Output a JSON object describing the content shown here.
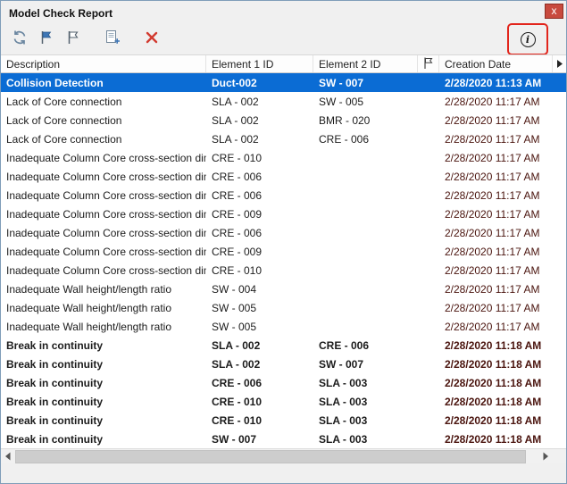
{
  "window": {
    "title": "Model Check Report",
    "close_glyph": "x"
  },
  "toolbar": {
    "icons": [
      {
        "name": "check-model-icon"
      },
      {
        "name": "flag-icon"
      },
      {
        "name": "unflag-icon"
      },
      {
        "name": "new-report-icon"
      },
      {
        "name": "delete-icon"
      },
      {
        "name": "info-icon"
      }
    ]
  },
  "table": {
    "columns": [
      "Description",
      "Element 1 ID",
      "Element 2 ID",
      "",
      "Creation Date"
    ],
    "flag_column_icon": "flag-icon",
    "rows": [
      {
        "description": "Collision Detection",
        "element1_id": "Duct-002",
        "element2_id": "SW - 007",
        "creation_date": "2/28/2020 11:13 AM",
        "selected": true,
        "bold": true
      },
      {
        "description": "Lack of Core connection",
        "element1_id": "SLA - 002",
        "element2_id": "SW - 005",
        "creation_date": "2/28/2020 11:17 AM",
        "selected": false,
        "bold": false
      },
      {
        "description": "Lack of Core connection",
        "element1_id": "SLA - 002",
        "element2_id": "BMR - 020",
        "creation_date": "2/28/2020 11:17 AM",
        "selected": false,
        "bold": false
      },
      {
        "description": "Lack of Core connection",
        "element1_id": "SLA - 002",
        "element2_id": "CRE - 006",
        "creation_date": "2/28/2020 11:17 AM",
        "selected": false,
        "bold": false
      },
      {
        "description": "Inadequate Column Core cross-section dim...",
        "element1_id": "CRE - 010",
        "element2_id": "",
        "creation_date": "2/28/2020 11:17 AM",
        "selected": false,
        "bold": false
      },
      {
        "description": "Inadequate Column Core cross-section dim...",
        "element1_id": "CRE - 006",
        "element2_id": "",
        "creation_date": "2/28/2020 11:17 AM",
        "selected": false,
        "bold": false
      },
      {
        "description": "Inadequate Column Core cross-section dim...",
        "element1_id": "CRE - 006",
        "element2_id": "",
        "creation_date": "2/28/2020 11:17 AM",
        "selected": false,
        "bold": false
      },
      {
        "description": "Inadequate Column Core cross-section dim...",
        "element1_id": "CRE - 009",
        "element2_id": "",
        "creation_date": "2/28/2020 11:17 AM",
        "selected": false,
        "bold": false
      },
      {
        "description": "Inadequate Column Core cross-section dim...",
        "element1_id": "CRE - 006",
        "element2_id": "",
        "creation_date": "2/28/2020 11:17 AM",
        "selected": false,
        "bold": false
      },
      {
        "description": "Inadequate Column Core cross-section dim...",
        "element1_id": "CRE - 009",
        "element2_id": "",
        "creation_date": "2/28/2020 11:17 AM",
        "selected": false,
        "bold": false
      },
      {
        "description": "Inadequate Column Core cross-section dim...",
        "element1_id": "CRE - 010",
        "element2_id": "",
        "creation_date": "2/28/2020 11:17 AM",
        "selected": false,
        "bold": false
      },
      {
        "description": "Inadequate Wall height/length ratio",
        "element1_id": "SW - 004",
        "element2_id": "",
        "creation_date": "2/28/2020 11:17 AM",
        "selected": false,
        "bold": false
      },
      {
        "description": "Inadequate Wall height/length ratio",
        "element1_id": "SW - 005",
        "element2_id": "",
        "creation_date": "2/28/2020 11:17 AM",
        "selected": false,
        "bold": false
      },
      {
        "description": "Inadequate Wall height/length ratio",
        "element1_id": "SW - 005",
        "element2_id": "",
        "creation_date": "2/28/2020 11:17 AM",
        "selected": false,
        "bold": false
      },
      {
        "description": "Break in continuity",
        "element1_id": "SLA - 002",
        "element2_id": "CRE - 006",
        "creation_date": "2/28/2020 11:18 AM",
        "selected": false,
        "bold": true
      },
      {
        "description": "Break in continuity",
        "element1_id": "SLA - 002",
        "element2_id": "SW - 007",
        "creation_date": "2/28/2020 11:18 AM",
        "selected": false,
        "bold": true
      },
      {
        "description": "Break in continuity",
        "element1_id": "CRE - 006",
        "element2_id": "SLA - 003",
        "creation_date": "2/28/2020 11:18 AM",
        "selected": false,
        "bold": true
      },
      {
        "description": "Break in continuity",
        "element1_id": "CRE - 010",
        "element2_id": "SLA - 003",
        "creation_date": "2/28/2020 11:18 AM",
        "selected": false,
        "bold": true
      },
      {
        "description": "Break in continuity",
        "element1_id": "CRE - 010",
        "element2_id": "SLA - 003",
        "creation_date": "2/28/2020 11:18 AM",
        "selected": false,
        "bold": true
      },
      {
        "description": "Break in continuity",
        "element1_id": "SW - 007",
        "element2_id": "SLA - 003",
        "creation_date": "2/28/2020 11:18 AM",
        "selected": false,
        "bold": true
      }
    ]
  },
  "colors": {
    "selection": "#0b6cd4",
    "date_text": "#4a140e",
    "delete_red": "#d23b30",
    "annotation_red": "#e2251c",
    "close_red": "#c84a3e",
    "window_border": "#7f9db9"
  }
}
